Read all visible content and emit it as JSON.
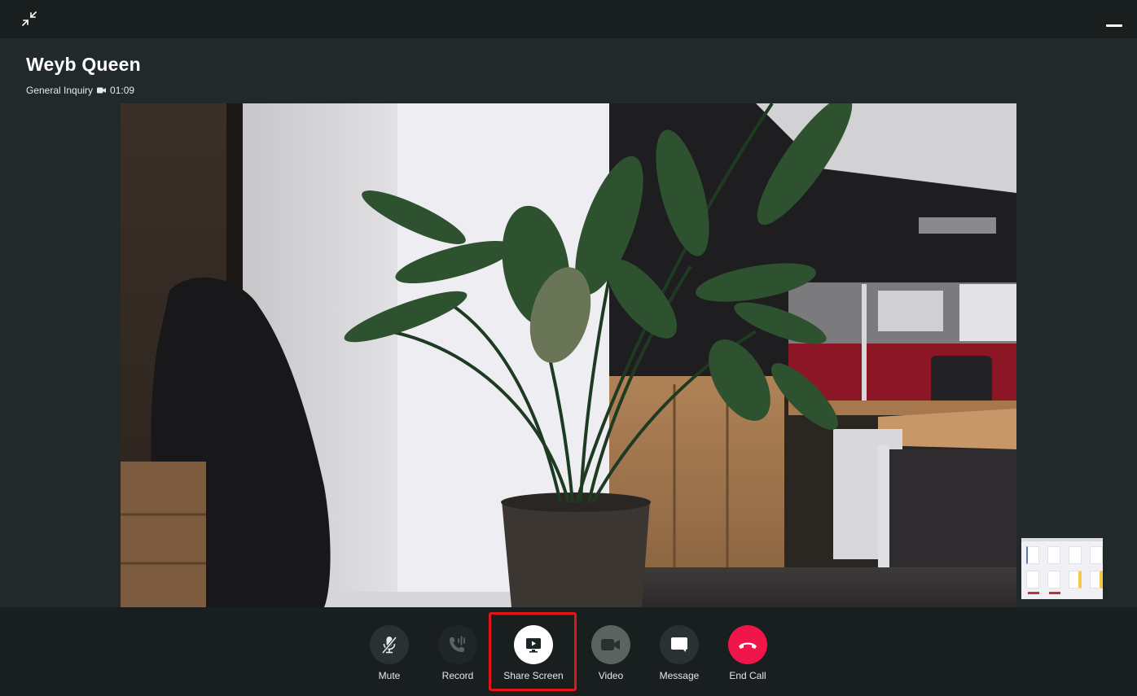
{
  "window": {
    "collapse_icon": "collapse-arrows-icon",
    "minimize_icon": "minimize-icon"
  },
  "call": {
    "caller_name": "Weyb Queen",
    "queue": "General Inquiry",
    "media_icon": "video-camera-icon",
    "duration": "01:09"
  },
  "video": {
    "main_feed": "remote-video-feed",
    "self_view": "screen-share-thumbnail"
  },
  "controls": [
    {
      "id": "mute",
      "label": "Mute",
      "icon": "microphone-off-icon",
      "bg": "#2a3133"
    },
    {
      "id": "record",
      "label": "Record",
      "icon": "phone-record-icon",
      "bg": "#202628"
    },
    {
      "id": "share-screen",
      "label": "Share Screen",
      "icon": "screen-share-icon",
      "bg": "#ffffff",
      "highlighted": true
    },
    {
      "id": "video",
      "label": "Video",
      "icon": "video-camera-icon",
      "bg": "#5b6361"
    },
    {
      "id": "message",
      "label": "Message",
      "icon": "chat-bubble-icon",
      "bg": "#2a3133"
    },
    {
      "id": "end-call",
      "label": "End Call",
      "icon": "hang-up-icon",
      "bg": "#f0164a"
    }
  ],
  "colors": {
    "topbar": "#191e1f",
    "background": "#22292b",
    "highlight": "#e3141b",
    "end_call": "#f0164a"
  }
}
